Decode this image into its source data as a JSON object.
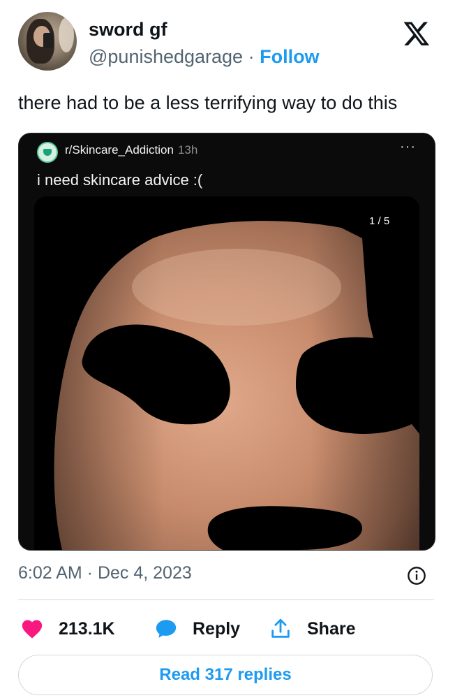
{
  "author": {
    "display_name": "sword gf",
    "handle": "@punishedgarage",
    "separator": " · ",
    "follow_label": "Follow"
  },
  "tweet": {
    "text": "there had to be a less terrifying way to do this"
  },
  "embed": {
    "subreddit": "r/Skincare_Addiction",
    "age": "13h",
    "more_label": "···",
    "title": "i need skincare advice :(",
    "image_counter": "1 / 5"
  },
  "meta": {
    "timestamp": "6:02 AM · Dec 4, 2023"
  },
  "actions": {
    "likes": "213.1K",
    "reply_label": "Reply",
    "share_label": "Share",
    "read_replies_label": "Read 317 replies"
  },
  "colors": {
    "accent": "#1d9bf0",
    "like": "#f91880",
    "text": "#0f1419",
    "secondary": "#536471"
  },
  "icons": {
    "x_logo": "x-logo-icon",
    "info": "info-icon",
    "like": "heart-icon",
    "reply": "speech-bubble-icon",
    "share": "share-upload-icon"
  }
}
